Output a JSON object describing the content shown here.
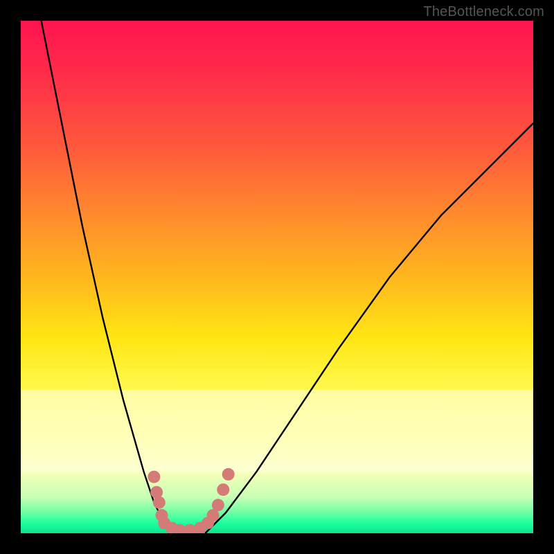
{
  "attribution": "TheBottleneck.com",
  "chart_data": {
    "type": "line",
    "title": "",
    "xlabel": "",
    "ylabel": "",
    "xlim": [
      0,
      100
    ],
    "ylim": [
      0,
      100
    ],
    "curve_left": {
      "name": "left-branch",
      "x": [
        4,
        8,
        12,
        16,
        20,
        24,
        26,
        28,
        30
      ],
      "y": [
        100,
        80,
        60,
        42,
        26,
        12,
        6,
        2,
        0
      ]
    },
    "curve_right": {
      "name": "right-branch",
      "x": [
        36,
        40,
        46,
        54,
        62,
        72,
        82,
        92,
        100
      ],
      "y": [
        0,
        4,
        12,
        24,
        36,
        50,
        62,
        72,
        80
      ]
    },
    "markers": {
      "name": "bottom-cluster",
      "color": "#d47b78",
      "points": [
        {
          "x": 26.0,
          "y": 11.0
        },
        {
          "x": 26.5,
          "y": 8.0
        },
        {
          "x": 27.0,
          "y": 6.0
        },
        {
          "x": 27.5,
          "y": 3.5
        },
        {
          "x": 28.0,
          "y": 2.0
        },
        {
          "x": 29.5,
          "y": 1.0
        },
        {
          "x": 31.0,
          "y": 0.6
        },
        {
          "x": 33.0,
          "y": 0.6
        },
        {
          "x": 35.0,
          "y": 1.0
        },
        {
          "x": 36.5,
          "y": 2.0
        },
        {
          "x": 37.5,
          "y": 3.5
        },
        {
          "x": 38.5,
          "y": 5.5
        },
        {
          "x": 39.5,
          "y": 8.5
        },
        {
          "x": 40.5,
          "y": 11.5
        }
      ]
    },
    "gradient_stops": [
      {
        "pos": 0.0,
        "color": "#ff1450"
      },
      {
        "pos": 0.1,
        "color": "#ff2b4a"
      },
      {
        "pos": 0.25,
        "color": "#ff5a3c"
      },
      {
        "pos": 0.38,
        "color": "#ff8b2d"
      },
      {
        "pos": 0.5,
        "color": "#ffb71e"
      },
      {
        "pos": 0.62,
        "color": "#ffe614"
      },
      {
        "pos": 0.72,
        "color": "#fff94e"
      },
      {
        "pos": 0.82,
        "color": "#ffff86"
      },
      {
        "pos": 0.88,
        "color": "#f7ffb8"
      },
      {
        "pos": 0.93,
        "color": "#c7ffb4"
      },
      {
        "pos": 0.96,
        "color": "#6cffa2"
      },
      {
        "pos": 0.98,
        "color": "#1effa0"
      },
      {
        "pos": 1.0,
        "color": "#0be38c"
      }
    ],
    "pale_band_y": [
      72,
      88
    ]
  }
}
